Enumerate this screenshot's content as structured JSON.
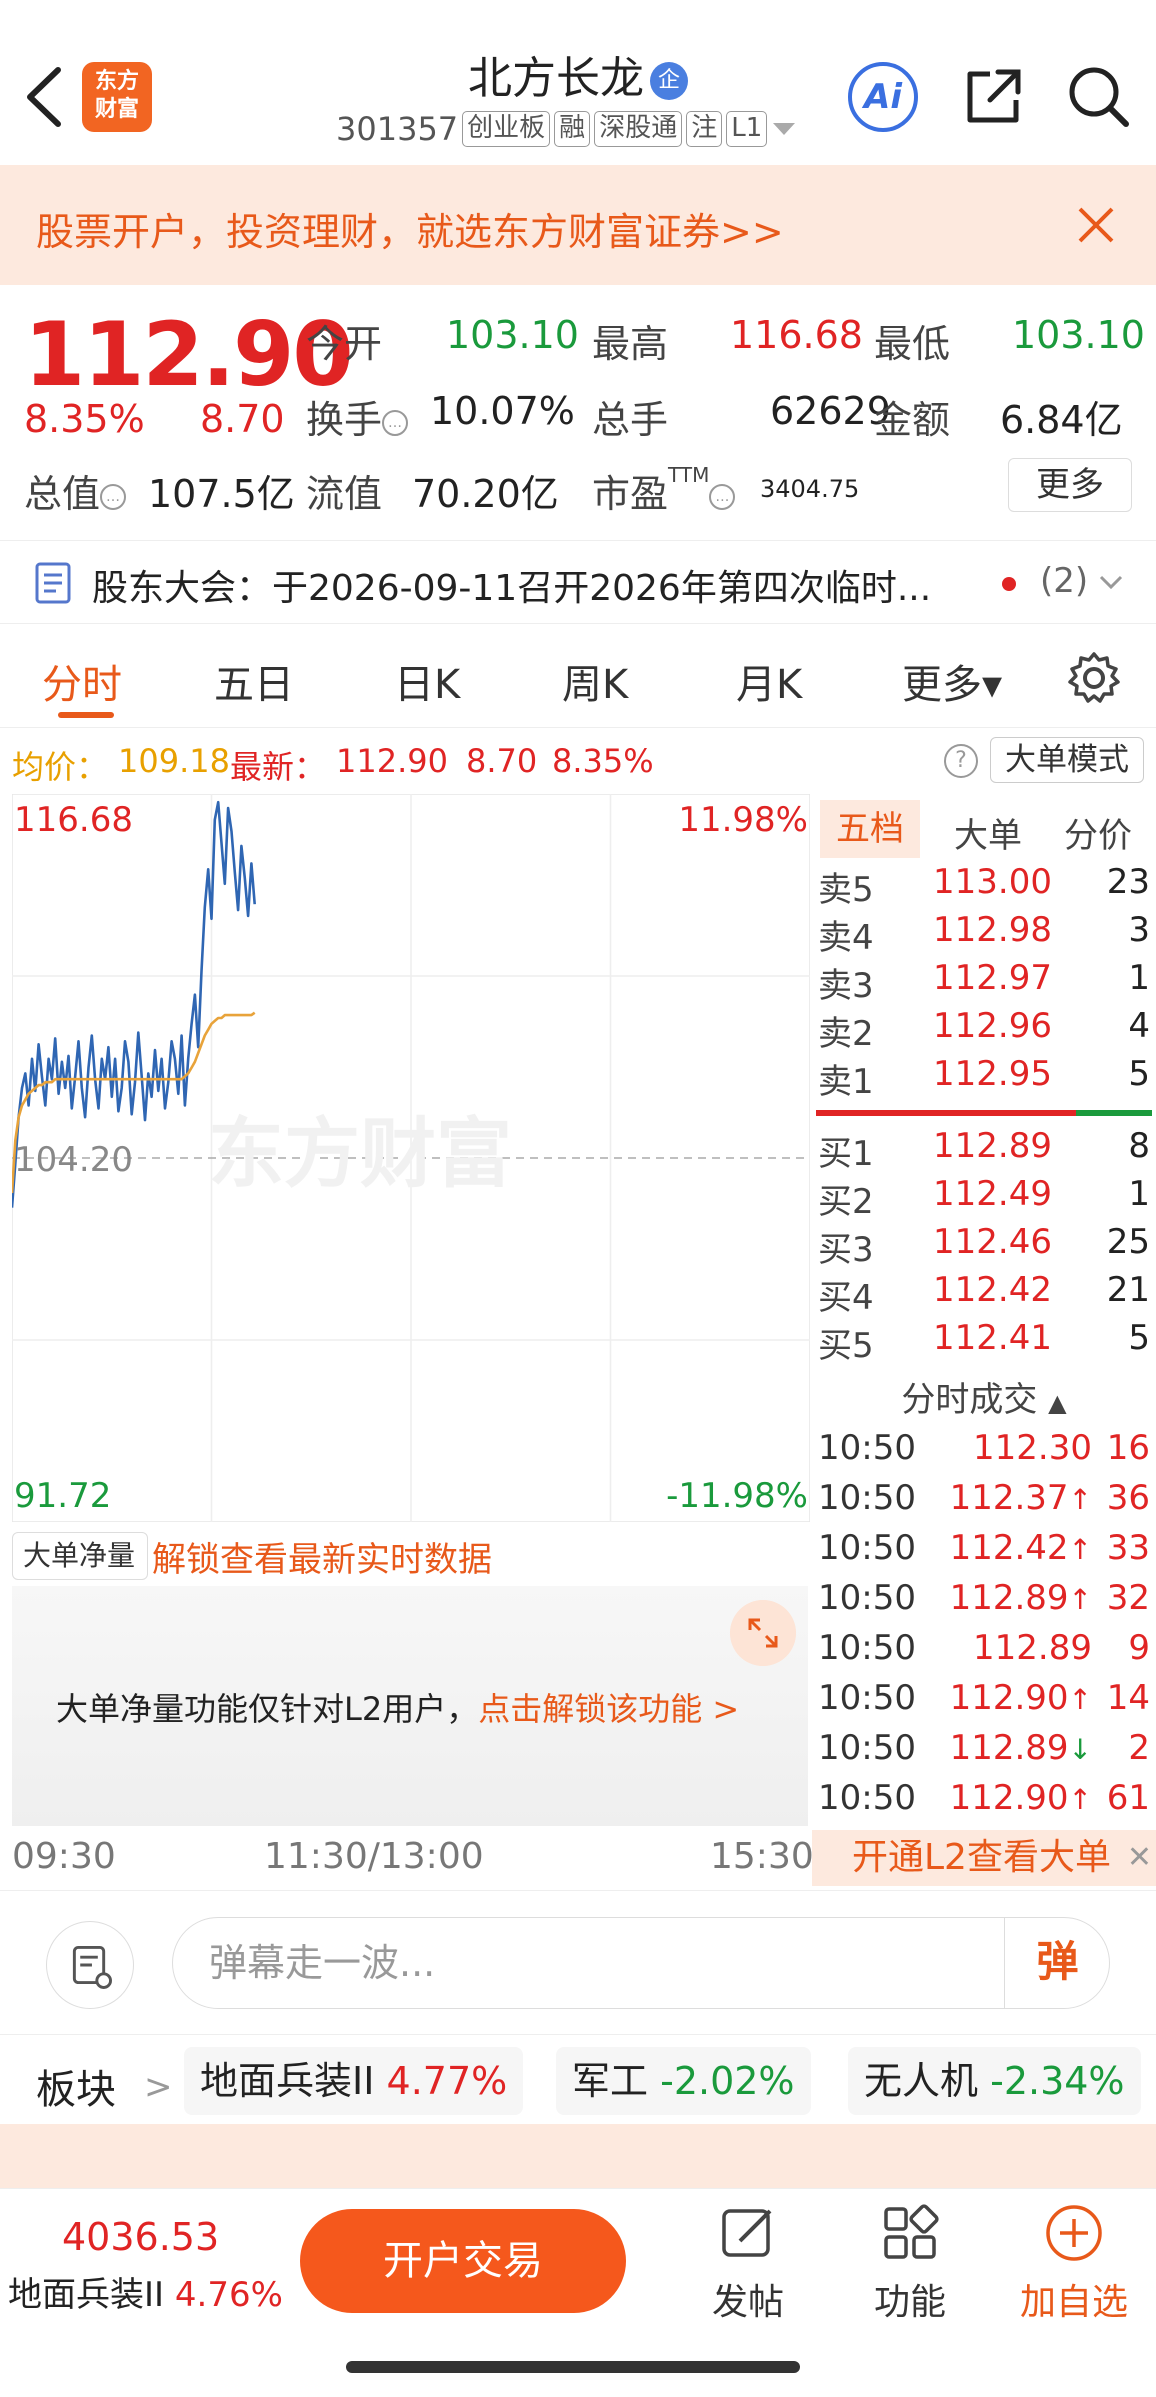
{
  "header": {
    "logo_line1": "东方",
    "logo_line2": "财富",
    "stock_name": "北方长龙",
    "qi_badge": "企",
    "code": "301357",
    "tags": [
      "创业板",
      "融",
      "深股通",
      "注",
      "L1"
    ],
    "ai_label": "Ai"
  },
  "banner": {
    "text": "股票开户，投资理财，就选东方财富证券>>"
  },
  "quote": {
    "price": "112.90",
    "change_pct": "8.35%",
    "change_amt": "8.70",
    "open_label": "今开",
    "open": "103.10",
    "high_label": "最高",
    "high": "116.68",
    "low_label": "最低",
    "low": "103.10",
    "turnover_label": "换手",
    "turnover": "10.07%",
    "volume_label": "总手",
    "volume": "62629",
    "amount_label": "金额",
    "amount": "6.84亿",
    "mktcap_label": "总值",
    "mktcap": "107.5亿",
    "float_label": "流值",
    "float": "70.20亿",
    "pe_label": "市盈",
    "pe_sup": "TTM",
    "pe": "3404.75",
    "more_label": "更多"
  },
  "notice": {
    "text": "股东大会：于2026-09-11召开2026年第四次临时...",
    "count": "(2)"
  },
  "tabs": [
    "分时",
    "五日",
    "日K",
    "周K",
    "月K",
    "更多▾"
  ],
  "avg_line": {
    "avg_label": "均价：",
    "avg": "109.18",
    "latest_label": "最新：",
    "latest": "112.90",
    "chg": "8.70",
    "pct": "8.35%",
    "mode_button": "大单模式"
  },
  "chart_data": {
    "type": "line",
    "y_left_top": "116.68",
    "y_left_mid": "104.20",
    "y_left_bottom": "91.72",
    "y_right_top": "11.98%",
    "y_right_bottom": "-11.98%",
    "ylim": [
      91.72,
      116.68
    ],
    "prev_close": 104.2,
    "x_labels": [
      "09:30",
      "11:30/13:00",
      "15:30"
    ],
    "watermark": "东方财富",
    "series": [
      {
        "values": [
          102.5,
          104.0,
          105.6,
          106.6,
          107.1,
          106.0,
          107.6,
          106.5,
          108.1,
          107.0,
          106.0,
          107.6,
          106.9,
          108.3,
          106.4,
          107.5,
          106.6,
          107.7,
          105.9,
          107.0,
          108.2,
          106.6,
          105.6,
          107.3,
          108.4,
          106.9,
          105.9,
          107.6,
          106.9,
          108.0,
          106.3,
          107.6,
          105.8,
          106.6,
          108.2,
          107.5,
          105.7,
          106.8,
          108.5,
          107.0,
          105.5,
          107.1,
          106.3,
          107.9,
          106.5,
          107.6,
          105.9,
          106.8,
          108.2,
          107.6,
          106.4,
          108.4,
          106.0,
          107.6,
          108.8,
          109.8,
          108.0,
          110.6,
          112.8,
          114.1,
          112.4,
          115.8,
          116.4,
          115.0,
          113.6,
          116.2,
          115.4,
          114.0,
          112.7,
          114.9,
          113.8,
          112.5,
          114.3,
          112.9
        ]
      },
      {
        "values": [
          103.0,
          104.8,
          105.6,
          106.0,
          106.2,
          106.4,
          106.5,
          106.6,
          106.7,
          106.7,
          106.8,
          106.8,
          106.8,
          106.9,
          106.9,
          106.9,
          106.9,
          106.9,
          106.9,
          106.9,
          106.9,
          106.9,
          106.9,
          106.9,
          106.9,
          106.9,
          106.9,
          106.9,
          106.9,
          106.9,
          106.9,
          106.9,
          106.9,
          106.9,
          106.9,
          106.9,
          106.9,
          106.9,
          106.9,
          106.9,
          106.9,
          106.9,
          106.9,
          106.9,
          106.9,
          106.9,
          106.9,
          106.9,
          106.9,
          106.9,
          106.9,
          106.9,
          107.0,
          107.1,
          107.3,
          107.5,
          107.8,
          108.1,
          108.4,
          108.6,
          108.8,
          108.9,
          109.0,
          109.0,
          109.1,
          109.1,
          109.1,
          109.1,
          109.1,
          109.1,
          109.1,
          109.1,
          109.1,
          109.18
        ]
      }
    ]
  },
  "book": {
    "tabs": [
      "五档",
      "大单",
      "分价"
    ],
    "asks": [
      {
        "label": "卖5",
        "price": "113.00",
        "vol": "23"
      },
      {
        "label": "卖4",
        "price": "112.98",
        "vol": "3"
      },
      {
        "label": "卖3",
        "price": "112.97",
        "vol": "1"
      },
      {
        "label": "卖2",
        "price": "112.96",
        "vol": "4"
      },
      {
        "label": "卖1",
        "price": "112.95",
        "vol": "5"
      }
    ],
    "bids": [
      {
        "label": "买1",
        "price": "112.89",
        "vol": "8"
      },
      {
        "label": "买2",
        "price": "112.49",
        "vol": "1"
      },
      {
        "label": "买3",
        "price": "112.46",
        "vol": "25"
      },
      {
        "label": "买4",
        "price": "112.42",
        "vol": "21"
      },
      {
        "label": "买5",
        "price": "112.41",
        "vol": "5"
      }
    ],
    "trade_header": "分时成交",
    "trades": [
      {
        "time": "10:50",
        "price": "112.30",
        "dir": "",
        "vol": "16",
        "color": "#e02424"
      },
      {
        "time": "10:50",
        "price": "112.37",
        "dir": "↑",
        "vol": "36",
        "color": "#e02424"
      },
      {
        "time": "10:50",
        "price": "112.42",
        "dir": "↑",
        "vol": "33",
        "color": "#e02424"
      },
      {
        "time": "10:50",
        "price": "112.89",
        "dir": "↑",
        "vol": "32",
        "color": "#e02424"
      },
      {
        "time": "10:50",
        "price": "112.89",
        "dir": "",
        "vol": "9",
        "color": "#e02424"
      },
      {
        "time": "10:50",
        "price": "112.90",
        "dir": "↑",
        "vol": "14",
        "color": "#e02424"
      },
      {
        "time": "10:50",
        "price": "112.89",
        "dir": "↓",
        "vol": "2",
        "color": "#e02424"
      },
      {
        "time": "10:50",
        "price": "112.90",
        "dir": "↑",
        "vol": "61",
        "color": "#e02424"
      }
    ],
    "l2_open": "开通L2查看大单"
  },
  "l2": {
    "dropdown": "大单净量",
    "unlock_text": "解锁查看最新实时数据",
    "msg": "大单净量功能仅针对L2用户，",
    "msg_link": "点击解锁该功能 >"
  },
  "comment": {
    "placeholder": "弹幕走一波...",
    "dan": "弹"
  },
  "sector": {
    "label": "板块",
    "chips": [
      {
        "name": "地面兵装II",
        "pct": "4.77%",
        "color": "#e02424"
      },
      {
        "name": "军工",
        "pct": "-2.02%",
        "color": "#1a9a3c"
      },
      {
        "name": "无人机",
        "pct": "-2.34%",
        "color": "#1a9a3c"
      }
    ]
  },
  "bottom": {
    "index_val": "4036.53",
    "index_name": "地面兵装II",
    "index_pct": "4.76%",
    "trade_button": "开户交易",
    "post": "发帖",
    "func": "功能",
    "add_watch": "加自选"
  }
}
